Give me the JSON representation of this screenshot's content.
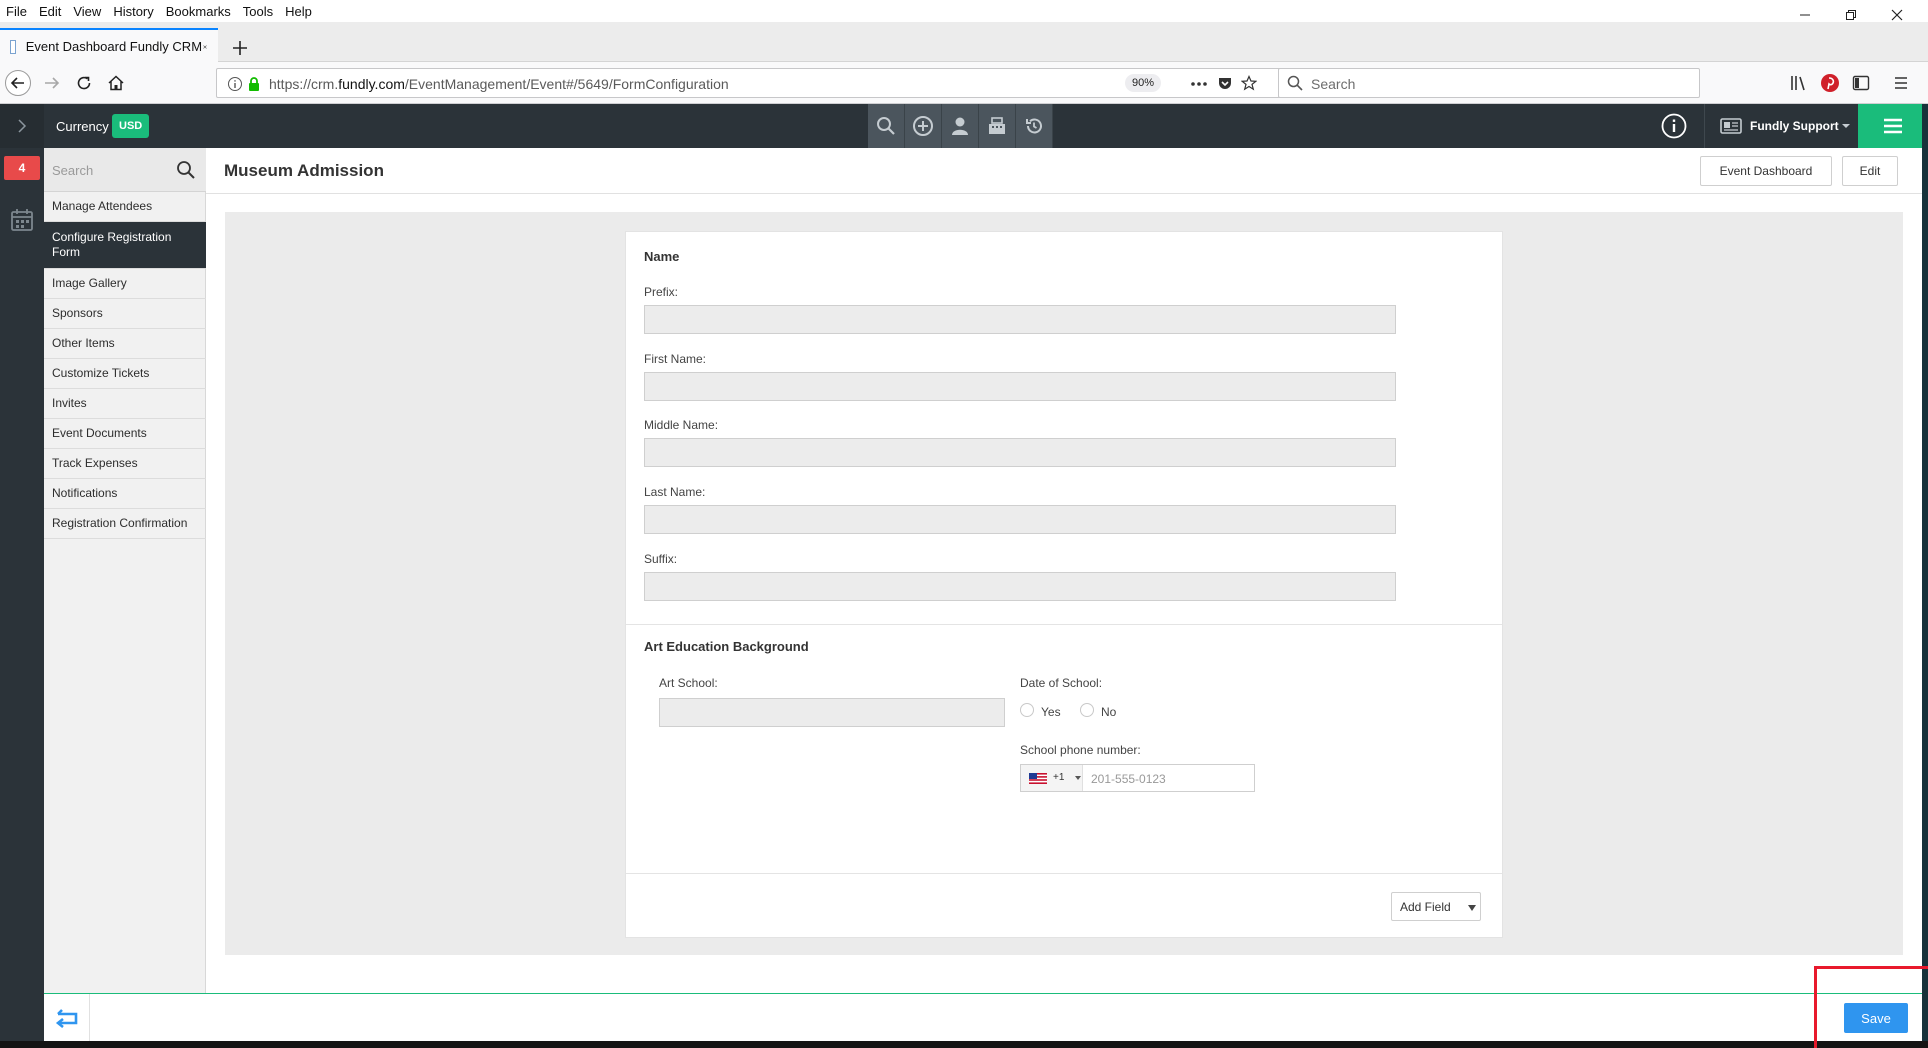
{
  "browser": {
    "menu": [
      "File",
      "Edit",
      "View",
      "History",
      "Bookmarks",
      "Tools",
      "Help"
    ],
    "tab_title": "Event Dashboard Fundly CRM",
    "url_prefix": "https://crm.",
    "url_domain": "fundly.com",
    "url_path": "/EventManagement/Event#/5649/FormConfiguration",
    "zoom": "90%",
    "search_placeholder": "Search"
  },
  "app": {
    "currency_label": "Currency",
    "currency_value": "USD",
    "user_menu": "Fundly Support",
    "notification_count": "4"
  },
  "sidebar": {
    "search_placeholder": "Search",
    "items": [
      {
        "label": "Manage Attendees",
        "active": false
      },
      {
        "label": "Configure Registration Form",
        "active": true
      },
      {
        "label": "Image Gallery",
        "active": false
      },
      {
        "label": "Sponsors",
        "active": false
      },
      {
        "label": "Other Items",
        "active": false
      },
      {
        "label": "Customize Tickets",
        "active": false
      },
      {
        "label": "Invites",
        "active": false
      },
      {
        "label": "Event Documents",
        "active": false
      },
      {
        "label": "Track Expenses",
        "active": false
      },
      {
        "label": "Notifications",
        "active": false
      },
      {
        "label": "Registration Confirmation",
        "active": false
      }
    ]
  },
  "main": {
    "title": "Museum Admission",
    "event_dashboard_label": "Event Dashboard",
    "edit_label": "Edit"
  },
  "form": {
    "name_section": {
      "title": "Name",
      "fields": [
        "Prefix:",
        "First Name:",
        "Middle Name:",
        "Last Name:",
        "Suffix:"
      ]
    },
    "art_section": {
      "title": "Art Education Background",
      "art_school_label": "Art School:",
      "date_of_school_label": "Date of School:",
      "yes_label": "Yes",
      "no_label": "No",
      "phone_label": "School phone number:",
      "phone_country_code": "+1",
      "phone_placeholder": "201-555-0123"
    },
    "add_field_label": "Add Field"
  },
  "footer": {
    "save_label": "Save"
  },
  "colors": {
    "accent_green": "#1abc7b",
    "dark_bar": "#2b3339",
    "save_blue": "#2f95ef",
    "alert_red": "#e84a4a",
    "highlight_red": "#e8192c"
  }
}
